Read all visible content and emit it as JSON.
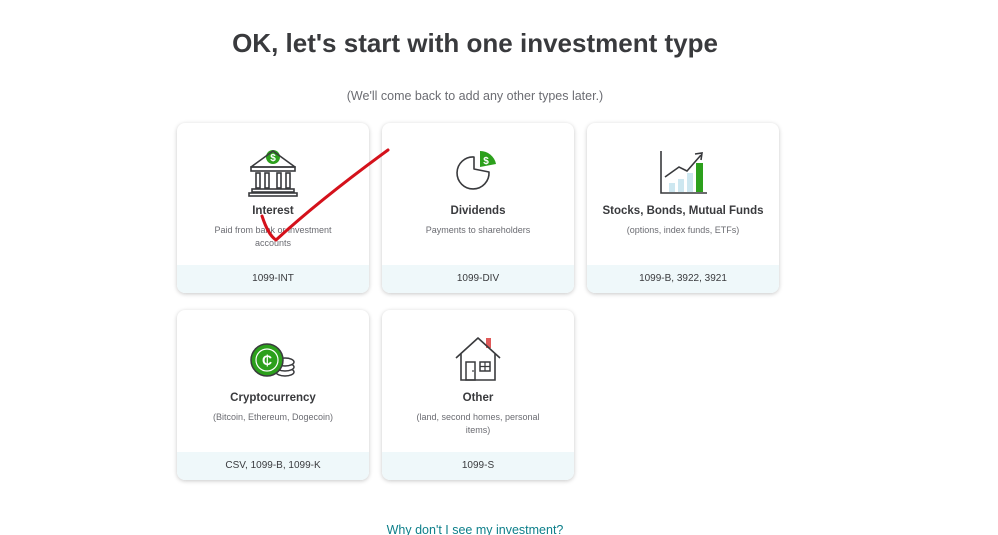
{
  "header": {
    "title": "OK, let's start with one investment type",
    "subtitle": "(We'll come back to add any other types later.)"
  },
  "cards": [
    {
      "name": "Interest",
      "desc": "Paid from bank or investment accounts",
      "forms": "1099-INT",
      "icon": "bank-icon"
    },
    {
      "name": "Dividends",
      "desc": "Payments to shareholders",
      "forms": "1099-DIV",
      "icon": "pie-chart-dollar-icon"
    },
    {
      "name": "Stocks, Bonds, Mutual Funds",
      "desc": "(options, index funds, ETFs)",
      "forms": "1099-B, 3922, 3921",
      "icon": "growth-chart-icon"
    },
    {
      "name": "Cryptocurrency",
      "desc": "(Bitcoin, Ethereum, Dogecoin)",
      "forms": "CSV, 1099-B, 1099-K",
      "icon": "crypto-coins-icon"
    },
    {
      "name": "Other",
      "desc": "(land, second homes, personal items)",
      "forms": "1099-S",
      "icon": "house-icon"
    }
  ],
  "footer": {
    "help_link": "Why don't I see my investment?"
  },
  "colors": {
    "accent_green": "#2ca01c",
    "icon_stroke": "#393a3d",
    "forms_bg": "#eff8fa",
    "link": "#0d7f8a",
    "annotation_red": "#d4111b"
  }
}
